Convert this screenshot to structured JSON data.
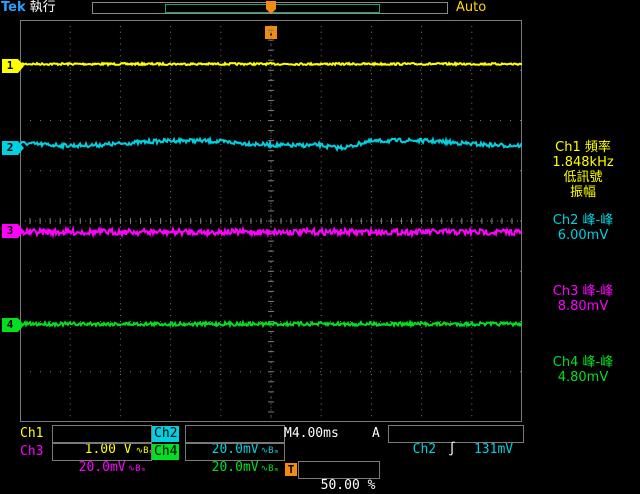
{
  "header": {
    "brand": "Tek",
    "status": "執行",
    "mode": "Auto"
  },
  "screen": {
    "trigger_position_label": "T",
    "trace_colors": {
      "ch1": "#ffff00",
      "ch2": "#00d0e0",
      "ch3": "#ff00ff",
      "ch4": "#00e020"
    },
    "grid_color": "#7a7a7a"
  },
  "channel_markers": [
    {
      "label": "1",
      "color": "#ffff00"
    },
    {
      "label": "2",
      "color": "#00d0e0"
    },
    {
      "label": "3",
      "color": "#ff00ff"
    },
    {
      "label": "4",
      "color": "#00e020"
    }
  ],
  "measurements": [
    {
      "title": "Ch1 頻率",
      "value": "1.848kHz",
      "extra1": "低訊號",
      "extra2": "振幅",
      "color": "#ffff00"
    },
    {
      "title": "Ch2 峰-峰",
      "value": "6.00mV",
      "color": "#00d0e0"
    },
    {
      "title": "Ch3 峰-峰",
      "value": "8.80mV",
      "color": "#ff00ff"
    },
    {
      "title": "Ch4 峰-峰",
      "value": "4.80mV",
      "color": "#00e020"
    }
  ],
  "readout": {
    "ch1_label": "Ch1",
    "ch1_scale": "1.00 V",
    "ch2_label": "Ch2",
    "ch2_scale": "20.0mV",
    "ch3_label": "Ch3",
    "ch3_scale": "20.0mV",
    "ch4_label": "Ch4",
    "ch4_scale": "20.0mV",
    "bw_symbol": "∿Bₘ",
    "timebase": "M4.00ms",
    "trig_mode": "A",
    "trig_source": "Ch2",
    "trig_slope": "∫",
    "trig_level": "131mV",
    "trig_pos_label": "T",
    "trig_pos": "50.00 %"
  }
}
